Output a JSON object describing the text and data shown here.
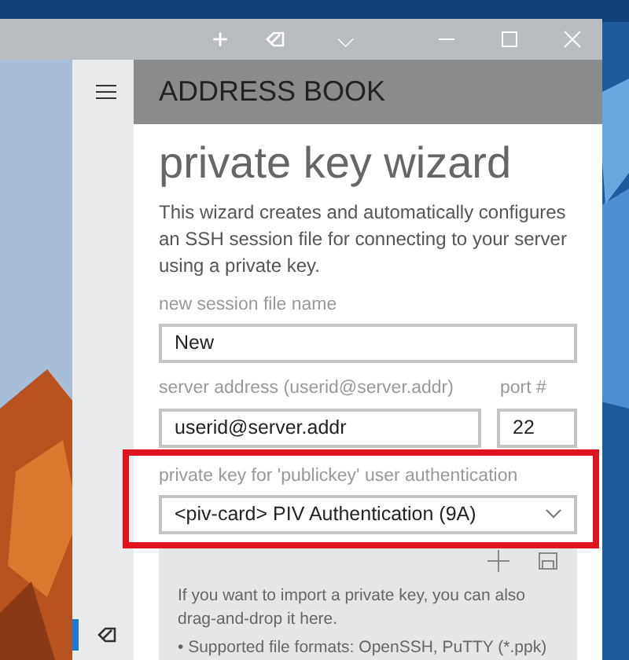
{
  "title_bar": {
    "buttons": [
      "+",
      "⌵"
    ]
  },
  "nav": {
    "items": [
      {
        "kind": "menu",
        "selected": false
      },
      {
        "kind": "tag",
        "selected": true
      }
    ]
  },
  "header": {
    "title": "ADDRESS BOOK"
  },
  "wizard": {
    "title": "private key wizard",
    "description": "This wizard creates and automatically configures an SSH session file for connecting to your server using a private key.",
    "session_name": {
      "label": "new session file name",
      "value": "New"
    },
    "server_address": {
      "label": "server address (userid@server.addr)",
      "value": "userid@server.addr"
    },
    "port": {
      "label": "port #",
      "value": "22"
    },
    "private_key": {
      "label": "private key for 'publickey' user authentication",
      "value": "<piv-card> PIV Authentication (9A)",
      "highlighted": true
    },
    "import_area": {
      "text": "If you want to import a private key, you can also drag-and-drop it here.",
      "formats": "• Supported file formats: OpenSSH, PuTTY (*.ppk)"
    }
  }
}
